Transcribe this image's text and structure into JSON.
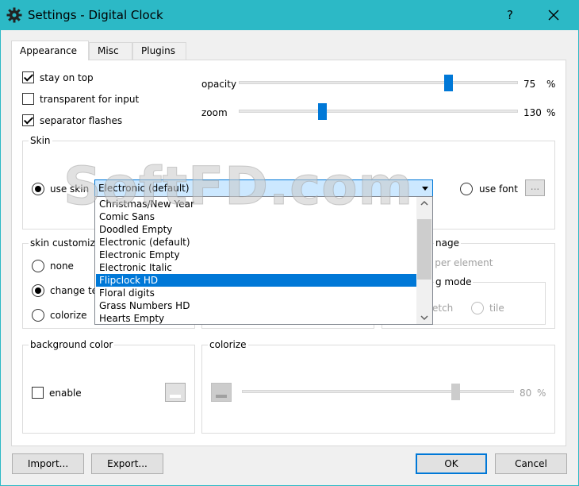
{
  "window": {
    "title": "Settings - Digital Clock",
    "help": "?"
  },
  "tabs": [
    {
      "label": "Appearance",
      "active": true
    },
    {
      "label": "Misc",
      "active": false
    },
    {
      "label": "Plugins",
      "active": false
    }
  ],
  "general": {
    "stay_on_top": "stay on top",
    "transparent_for_input": "transparent for input",
    "separator_flashes": "separator flashes"
  },
  "opacity": {
    "label": "opacity",
    "value": "75",
    "unit": "%",
    "fraction": 0.75
  },
  "zoom": {
    "label": "zoom",
    "value": "130",
    "unit": "%",
    "fraction": 0.3
  },
  "skin": {
    "group_title": "Skin",
    "use_skin": "use skin",
    "selected": "Electronic (default)",
    "use_font": "use font",
    "font_button": "...",
    "options": [
      "Christmas/New Year",
      "Comic Sans",
      "Doodled Empty",
      "Electronic (default)",
      "Electronic Empty",
      "Electronic Italic",
      "Flipclock HD",
      "Floral digits",
      "Grass Numbers HD",
      "Hearts Empty"
    ],
    "highlighted": "Flipclock HD"
  },
  "skin_custom": {
    "group_title": "skin customiza",
    "none": "none",
    "change": "change te",
    "colorize": "colorize"
  },
  "texture": {
    "title_fragment": "nage",
    "per_element": "e per element",
    "mode_title": "g mode",
    "stretch": "etch",
    "tile": "tile"
  },
  "background_color": {
    "group_title": "background color",
    "enable": "enable"
  },
  "colorize_group": {
    "group_title": "colorize",
    "value": "80",
    "unit": "%"
  },
  "buttons": {
    "import": "Import...",
    "export": "Export...",
    "ok": "OK",
    "cancel": "Cancel"
  },
  "watermark": "SoftFD.com",
  "colors": {
    "accent": "#0078d7",
    "titlebar": "#2cb9c6"
  }
}
